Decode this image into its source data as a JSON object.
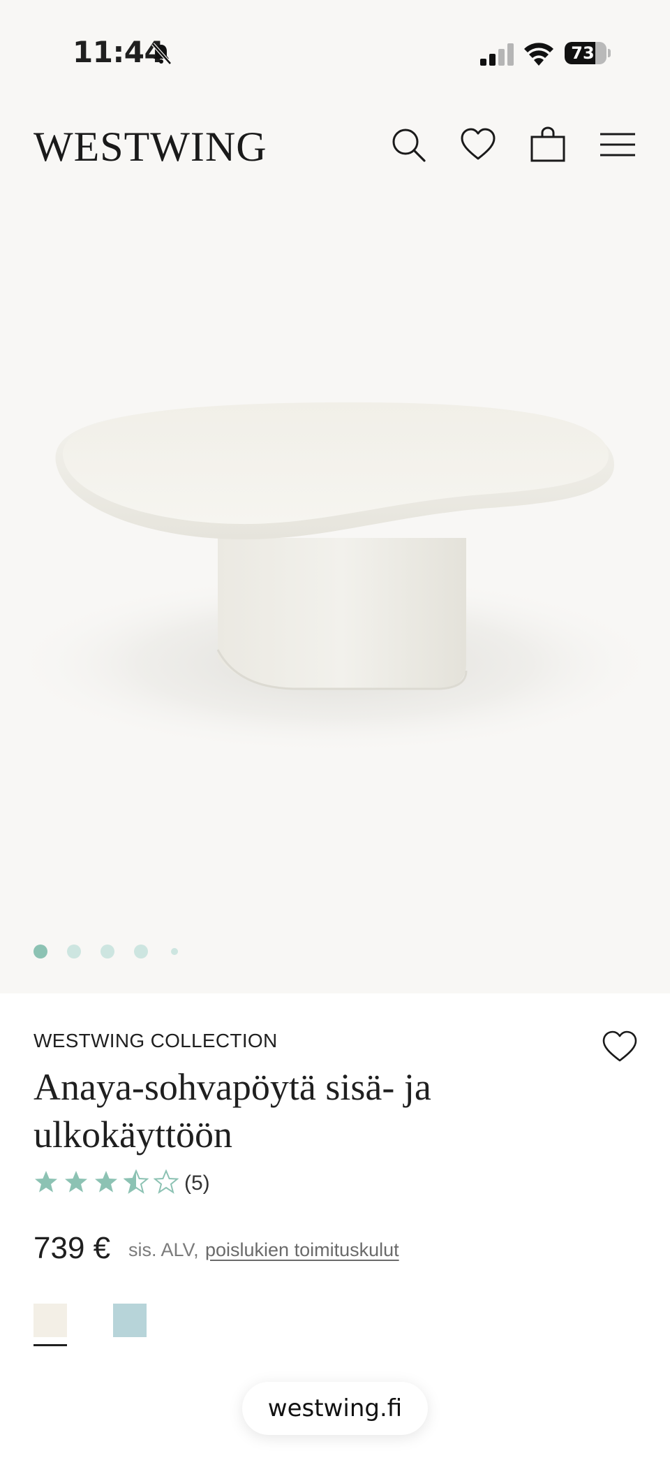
{
  "status_bar": {
    "time": "11:44",
    "battery_percent": "73",
    "battery_level": 0.73,
    "icons": [
      "bell-slash-icon",
      "signal-icon",
      "wifi-icon",
      "battery-icon"
    ]
  },
  "header": {
    "logo": "WESTWING",
    "icons": [
      "search-icon",
      "heart-icon",
      "shopping-bag-icon",
      "menu-icon"
    ]
  },
  "gallery": {
    "image_description_icon": "coffee-table-photo",
    "total_images": 5,
    "active_index": 0
  },
  "product": {
    "brand": "WESTWING COLLECTION",
    "title": "Anaya-sohvapöytä sisä- ja ulkokäyttöön",
    "rating": 3.5,
    "rating_max": 5,
    "review_count": "(5)",
    "price": "739 €",
    "vat_text": "sis. ALV,",
    "shipping_text": "poislukien toimituskulut",
    "swatches": [
      {
        "color": "#f3efe6",
        "selected": true
      },
      {
        "color": "#b7d4d9",
        "selected": false
      }
    ]
  },
  "colors": {
    "accent": "#8cc2b3",
    "dot_inactive": "#cde5e0"
  },
  "browser": {
    "url": "westwing.fi"
  }
}
